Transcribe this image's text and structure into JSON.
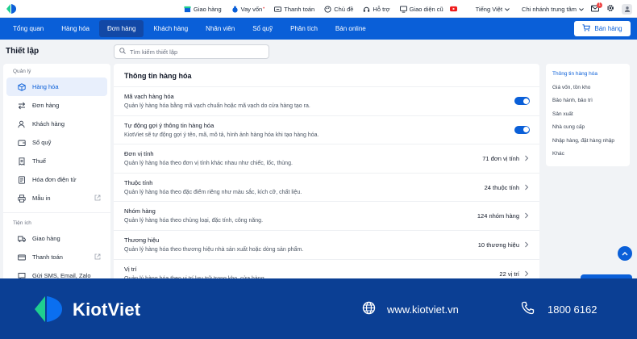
{
  "colors": {
    "brand_blue": "#0a5fd8",
    "nav_active": "#1248a6",
    "footer_blue": "#0b3f94",
    "logo_green": "#1fcf8f"
  },
  "topbar": {
    "links": [
      {
        "icon": "store-icon",
        "label": "Giao hàng"
      },
      {
        "icon": "money-bag-icon",
        "label": "Vay vốn"
      },
      {
        "icon": "payment-icon",
        "label": "Thanh toán"
      },
      {
        "icon": "palette-icon",
        "label": "Chủ đề"
      },
      {
        "icon": "support-icon",
        "label": "Hỗ trợ"
      },
      {
        "icon": "monitor-icon",
        "label": "Giao diện cũ"
      },
      {
        "icon": "youtube-icon",
        "label": ""
      }
    ],
    "language": "Tiếng Việt",
    "branch": "Chi nhánh trung tâm",
    "notification_count": "1"
  },
  "nav": {
    "items": [
      "Tổng quan",
      "Hàng hóa",
      "Đơn hàng",
      "Khách hàng",
      "Nhân viên",
      "Sổ quỹ",
      "Phân tích",
      "Bán online"
    ],
    "active_index": 2,
    "sell_button": "Bán hàng"
  },
  "page": {
    "title": "Thiết lập"
  },
  "search": {
    "placeholder": "Tìm kiếm thiết lập"
  },
  "sidebar": {
    "group1": "Quản lý",
    "items1": [
      {
        "icon": "box-icon",
        "label": "Hàng hóa",
        "active": true
      },
      {
        "icon": "swap-icon",
        "label": "Đơn hàng"
      },
      {
        "icon": "user-icon",
        "label": "Khách hàng"
      },
      {
        "icon": "wallet-icon",
        "label": "Sổ quỹ"
      },
      {
        "icon": "tax-icon",
        "label": "Thuế"
      },
      {
        "icon": "invoice-icon",
        "label": "Hóa đơn điện tử"
      },
      {
        "icon": "printer-icon",
        "label": "Mẫu in",
        "external": true
      }
    ],
    "group2": "Tiện ích",
    "items2": [
      {
        "icon": "truck-icon",
        "label": "Giao hàng"
      },
      {
        "icon": "card-icon",
        "label": "Thanh toán",
        "external": true
      },
      {
        "icon": "sms-icon",
        "label": "Gửi SMS, Email, Zalo"
      }
    ]
  },
  "main": {
    "title": "Thông tin hàng hóa",
    "rows": [
      {
        "title": "Mã vạch hàng hóa",
        "desc": "Quản lý hàng hóa bằng mã vạch chuẩn hoặc mã vạch do cửa hàng tạo ra.",
        "toggle": true
      },
      {
        "title": "Tự động gợi ý thông tin hàng hóa",
        "desc": "KiotViet sẽ tự động gợi ý tên, mã, mô tả, hình ảnh hàng hóa khi tạo hàng hóa.",
        "toggle": true
      },
      {
        "title": "Đơn vị tính",
        "desc": "Quản lý hàng hóa theo đơn vị tính khác nhau như chiếc, lốc, thùng.",
        "value": "71 đơn vị tính"
      },
      {
        "title": "Thuộc tính",
        "desc": "Quản lý hàng hóa theo đặc điểm riêng như màu sắc, kích cỡ, chất liệu.",
        "value": "24 thuộc tính"
      },
      {
        "title": "Nhóm hàng",
        "desc": "Quản lý hàng hóa theo chủng loại, đặc tính, công năng.",
        "value": "124 nhóm hàng"
      },
      {
        "title": "Thương hiệu",
        "desc": "Quản lý hàng hóa theo thương hiệu nhà sản xuất hoặc dòng sản phẩm.",
        "value": "10 thương hiệu"
      },
      {
        "title": "Vị trí",
        "desc": "Quản lý hàng hóa theo vị trí lưu trữ trong kho, cửa hàng.",
        "value": "22 vị trí"
      }
    ]
  },
  "toc": [
    "Thông tin hàng hóa",
    "Giá vốn, tồn kho",
    "Bảo hành, bảo trì",
    "Sản xuất",
    "Nhà cung cấp",
    "Nhập hàng, đặt hàng nhập",
    "Khác"
  ],
  "footer": {
    "brand": "KiotViet",
    "website": "www.kiotviet.vn",
    "phone": "1800 6162"
  }
}
